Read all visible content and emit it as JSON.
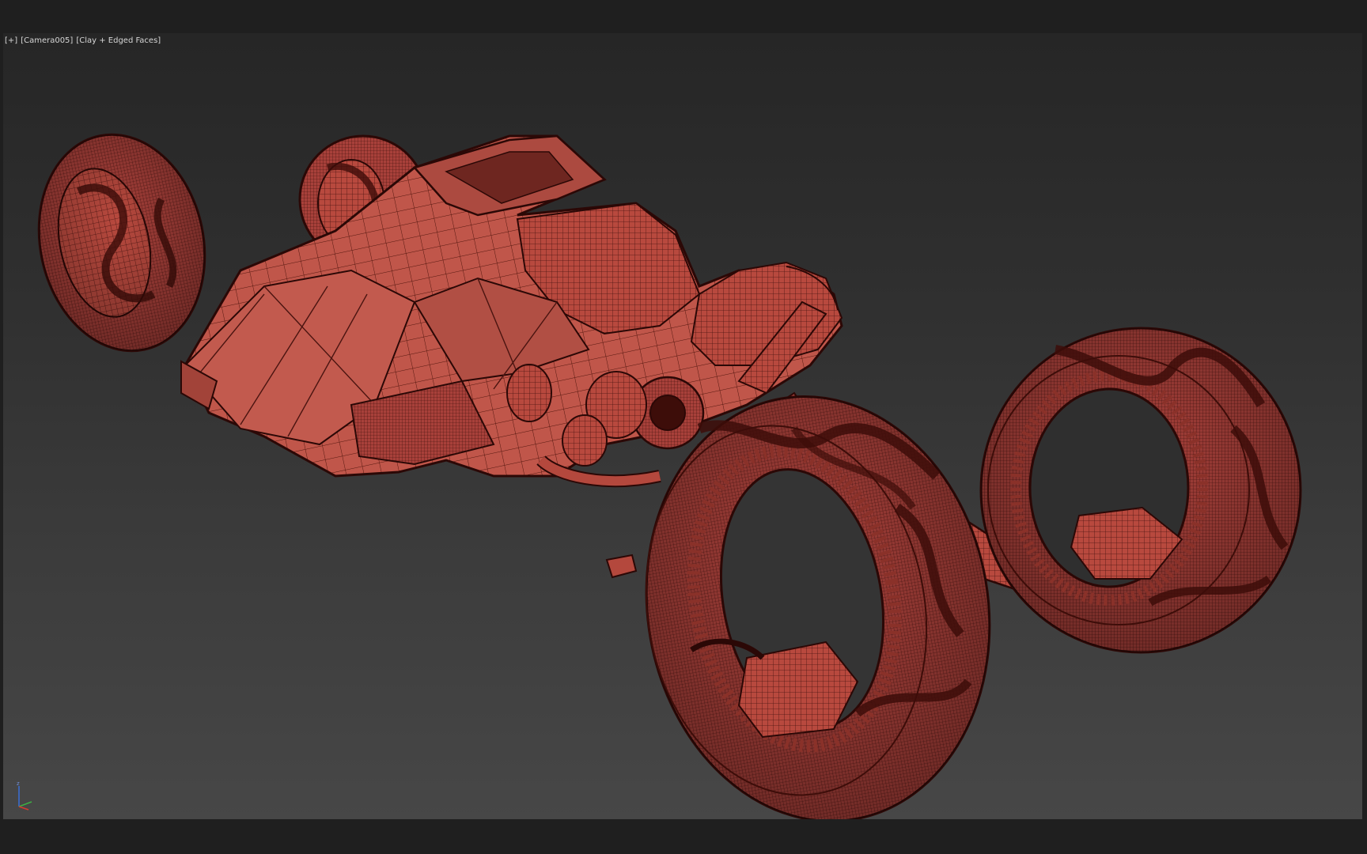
{
  "viewport": {
    "label_plus": "[+]",
    "label_camera": "[Camera005]",
    "label_shading": "[Clay + Edged Faces]"
  },
  "scene": {
    "object": "motorcycle",
    "material_color": "#b64a3f",
    "wire_color": "#3a0f0c",
    "shadow_color": "#6e2620",
    "highlight_color": "#d97a6c"
  },
  "gizmo": {
    "z_axis": "z",
    "x_axis_color": "#d43b2f",
    "y_axis_color": "#3cb043",
    "z_axis_color": "#3a6fd6"
  }
}
